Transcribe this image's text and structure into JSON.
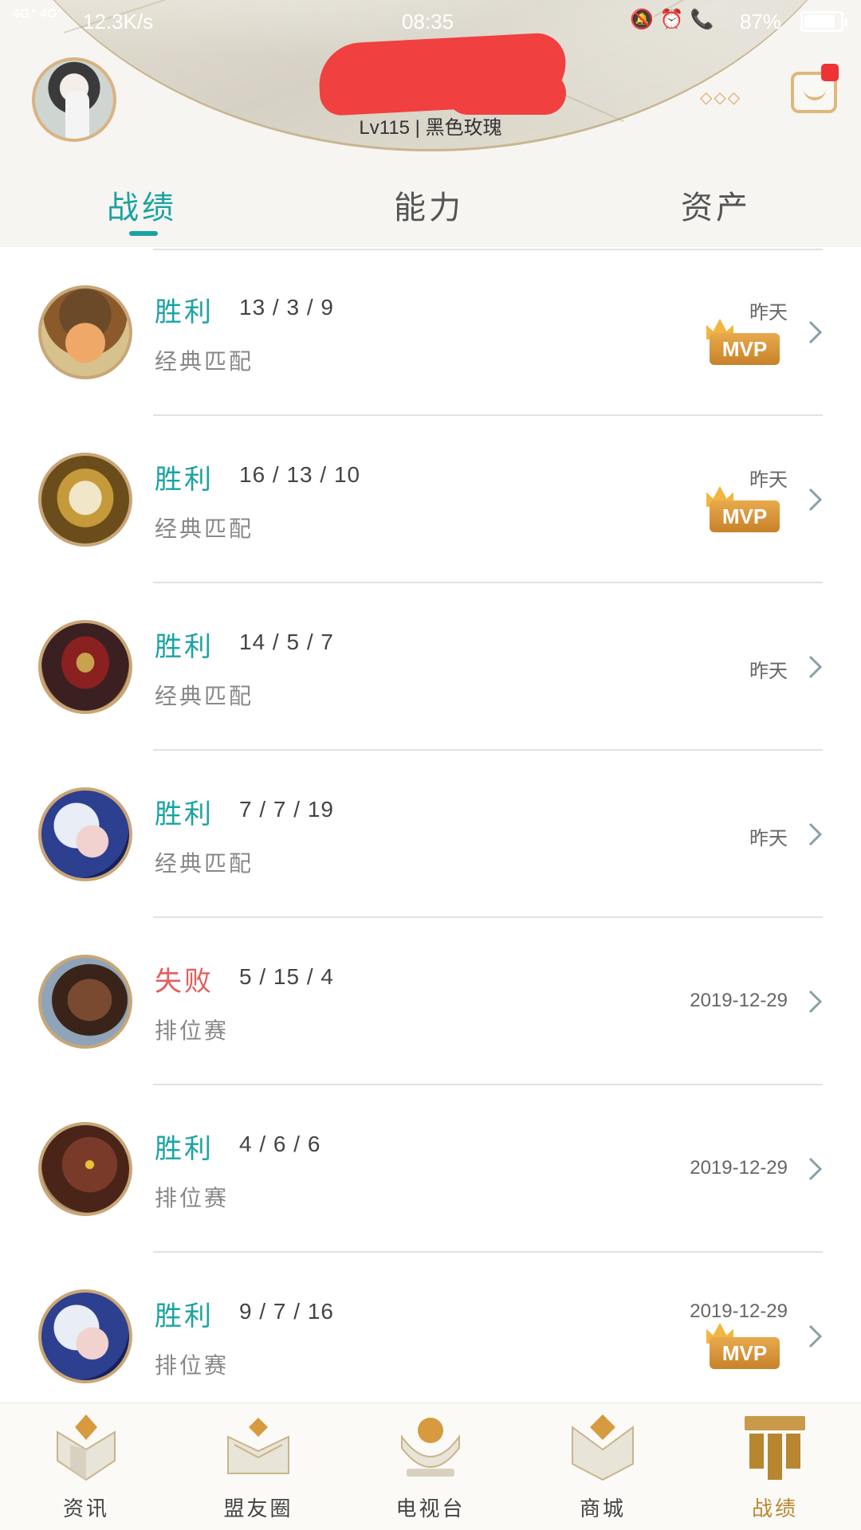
{
  "status_bar": {
    "signal": "4G⁺ 4G⁺",
    "speed": "12.3K/s",
    "time": "08:35",
    "icons": "🔕⏰📞",
    "battery": "87%"
  },
  "profile": {
    "level_text": "Lv115 | 黑色玫瑰"
  },
  "tabs": [
    {
      "label": "战绩",
      "active": true
    },
    {
      "label": "能力",
      "active": false
    },
    {
      "label": "资产",
      "active": false
    }
  ],
  "matches": [
    {
      "result": "胜利",
      "outcome": "win",
      "kda": "13 / 3 / 9",
      "mode": "经典匹配",
      "date": "昨天",
      "mvp": true,
      "champion_icon": "teemo-icon"
    },
    {
      "result": "胜利",
      "outcome": "win",
      "kda": "16 / 13 / 10",
      "mode": "经典匹配",
      "date": "昨天",
      "mvp": true,
      "champion_icon": "pantheon-icon"
    },
    {
      "result": "胜利",
      "outcome": "win",
      "kda": "14 / 5 / 7",
      "mode": "经典匹配",
      "date": "昨天",
      "mvp": false,
      "champion_icon": "zed-icon"
    },
    {
      "result": "胜利",
      "outcome": "win",
      "kda": "7 / 7 / 19",
      "mode": "经典匹配",
      "date": "昨天",
      "mvp": false,
      "champion_icon": "ashe-icon"
    },
    {
      "result": "失败",
      "outcome": "lose",
      "kda": "5 / 15 / 4",
      "mode": "排位赛",
      "date": "2019-12-29",
      "mvp": false,
      "champion_icon": "lucian-icon"
    },
    {
      "result": "胜利",
      "outcome": "win",
      "kda": "4 / 6 / 6",
      "mode": "排位赛",
      "date": "2019-12-29",
      "mvp": false,
      "champion_icon": "wukong-icon"
    },
    {
      "result": "胜利",
      "outcome": "win",
      "kda": "9 / 7 / 16",
      "mode": "排位赛",
      "date": "2019-12-29",
      "mvp": true,
      "champion_icon": "ashe-icon"
    }
  ],
  "mvp_label": "MVP",
  "bottom_nav": [
    {
      "label": "资讯",
      "active": false
    },
    {
      "label": "盟友圈",
      "active": false
    },
    {
      "label": "电视台",
      "active": false
    },
    {
      "label": "商城",
      "active": false
    },
    {
      "label": "战绩",
      "active": true
    }
  ],
  "colors": {
    "accent": "#1aa3a2",
    "lose": "#e45c5c",
    "gold": "#b8862f",
    "mvp": "#d8922f"
  }
}
